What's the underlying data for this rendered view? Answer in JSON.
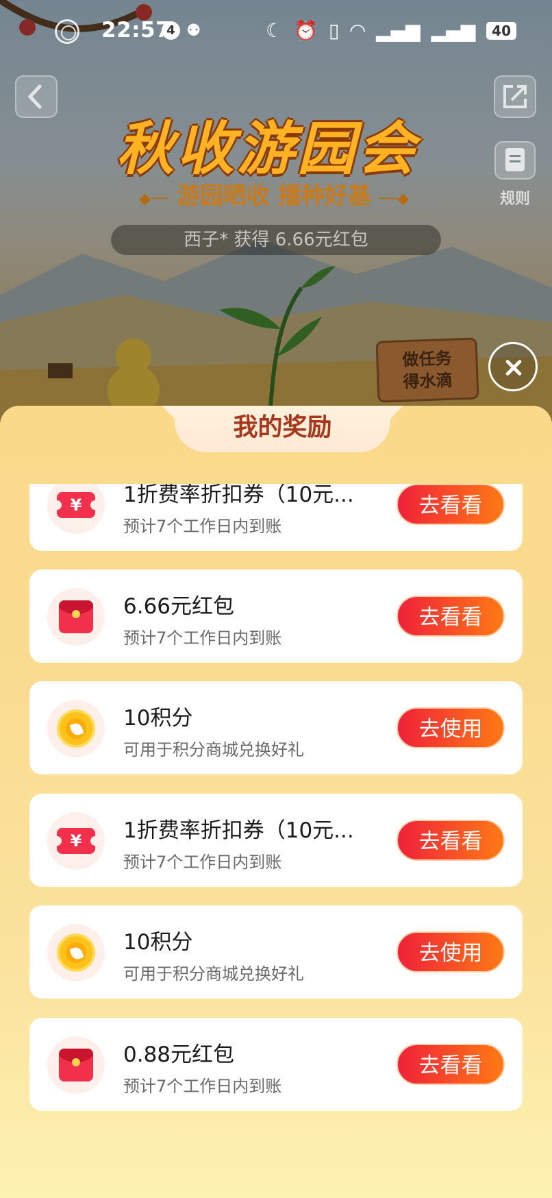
{
  "status_bar": {
    "time": "22:57",
    "notification_count": "4",
    "battery": "40"
  },
  "header": {
    "event_title": "秋收游园会",
    "event_subtitle": "游园晒收 播种好基",
    "ticker_text": "西子* 获得 6.66元红包",
    "rules_label": "规则",
    "task_sign_line1": "做任务",
    "task_sign_line2": "得水滴"
  },
  "sheet": {
    "title": "我的奖励",
    "rewards": [
      {
        "icon": "coupon-icon",
        "title": "1折费率折扣券（10元...",
        "desc": "预计7个工作日内到账",
        "action": "去看看"
      },
      {
        "icon": "red-envelope-icon",
        "title": "6.66元红包",
        "desc": "预计7个工作日内到账",
        "action": "去看看"
      },
      {
        "icon": "points-coin-icon",
        "title": "10积分",
        "desc": "可用于积分商城兑换好礼",
        "action": "去使用"
      },
      {
        "icon": "coupon-icon",
        "title": "1折费率折扣券（10元...",
        "desc": "预计7个工作日内到账",
        "action": "去看看"
      },
      {
        "icon": "points-coin-icon",
        "title": "10积分",
        "desc": "可用于积分商城兑换好礼",
        "action": "去使用"
      },
      {
        "icon": "red-envelope-icon",
        "title": "0.88元红包",
        "desc": "预计7个工作日内到账",
        "action": "去看看"
      }
    ]
  },
  "colors": {
    "action_gradient_start": "#f0213a",
    "action_gradient_end": "#ff7a14",
    "sheet_title": "#a8361b",
    "sheet_background": "#fbd98a"
  }
}
